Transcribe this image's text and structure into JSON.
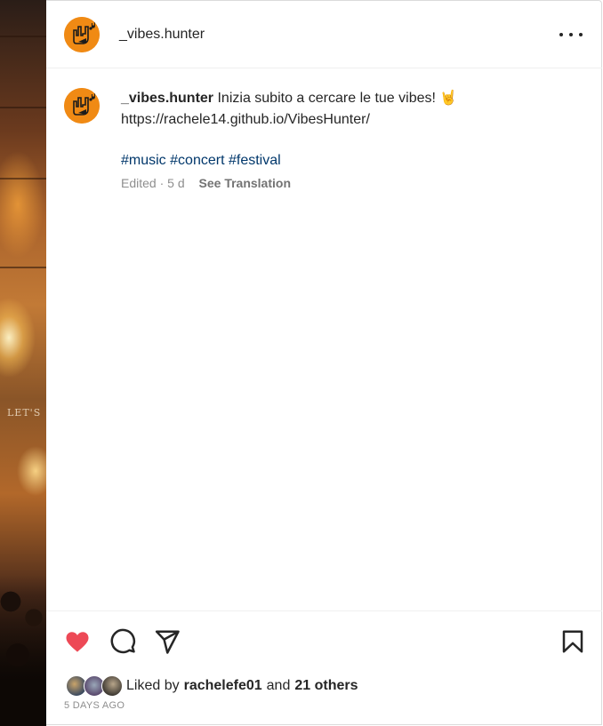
{
  "post": {
    "username": "_vibes.hunter",
    "caption_text": "Inizia subito a cercare le tue vibes! 🤘",
    "caption_link": "https://rachele14.github.io/VibesHunter/",
    "hashtags": [
      "#music",
      "#concert",
      "#festival"
    ],
    "edited_label": "Edited",
    "separator": "·",
    "age_short": "5 d",
    "see_translation": "See Translation"
  },
  "photo": {
    "sign_text": "LET'S"
  },
  "engagement": {
    "liked_by_prefix": "Liked by",
    "liked_by_user": "rachelefe01",
    "liked_by_and": "and",
    "liked_by_others": "21 others",
    "time_ago": "5 DAYS AGO",
    "liked": true
  },
  "icons": {
    "more": "more-options-icon",
    "like": "heart-icon",
    "comment": "comment-icon",
    "share": "share-icon",
    "save": "bookmark-icon"
  },
  "colors": {
    "accent_like": "#ed4956",
    "hashtag": "#00376b",
    "avatar_bg": "#f08a14",
    "muted": "#8e8e8e"
  }
}
